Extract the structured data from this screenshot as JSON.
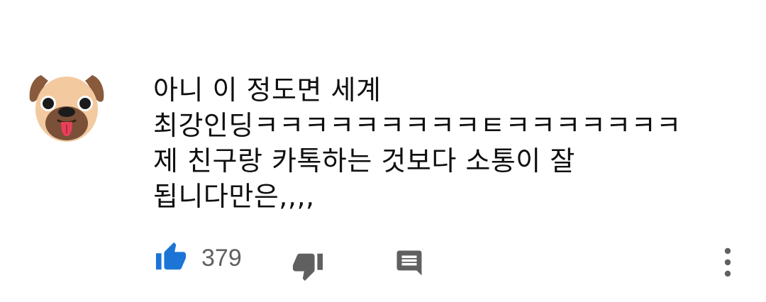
{
  "comment": {
    "avatar_icon": "pug-avatar-icon",
    "text_lines": [
      "아니 이 정도면 세계",
      "최강인딩ㅋㅋㅋㅋㅋㅋㅋㅋㅋㅌㅋㅋㅋㅋㅋㅋㅋ",
      "제 친구랑 카톡하는 것보다 소통이 잘",
      "됩니다만은,,,,"
    ],
    "like_count": "379"
  },
  "icons": {
    "like": "thumbs-up-icon",
    "dislike": "thumbs-down-icon",
    "reply": "reply-comment-icon",
    "more": "more-vertical-icon"
  },
  "colors": {
    "like_active": "#1c74d6",
    "icon_gray": "#606060",
    "text": "#0f0f0f",
    "count": "#606060"
  }
}
